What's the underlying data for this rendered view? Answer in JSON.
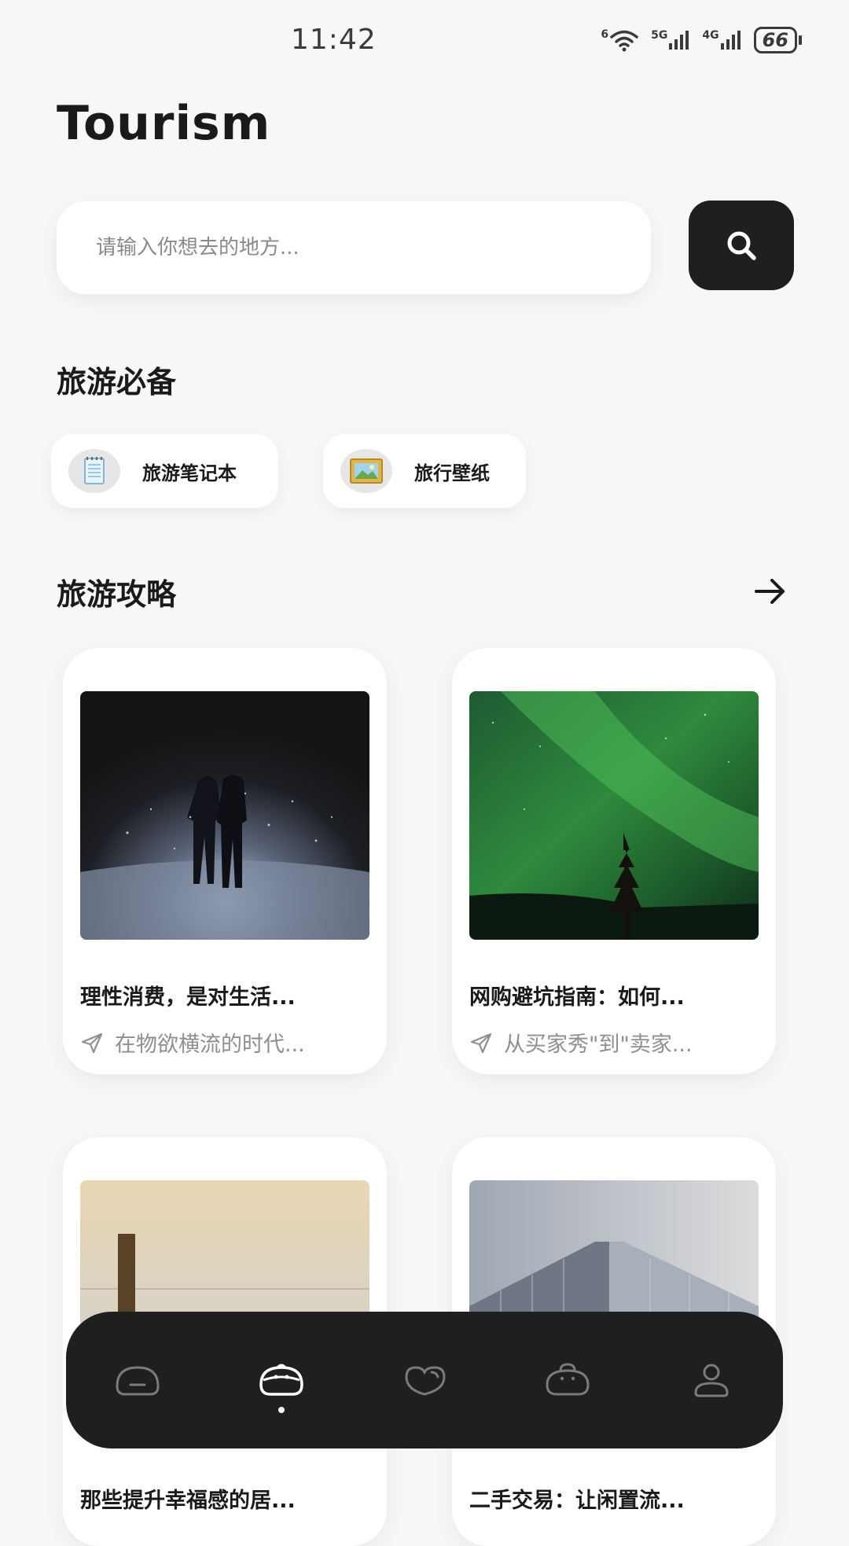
{
  "status_bar": {
    "time": "11:42",
    "wifi_label": "6",
    "signal_1_label": "5G",
    "signal_2_label": "4G",
    "battery": "66",
    "icons": [
      "wifi-icon",
      "signal-icon",
      "signal-icon",
      "battery-icon"
    ]
  },
  "header": {
    "title": "Tourism"
  },
  "search": {
    "placeholder": "请输入你想去的地方...",
    "value": "",
    "button_icon": "search-icon"
  },
  "essentials": {
    "title": "旅游必备",
    "items": [
      {
        "label": "旅游笔记本",
        "icon": "notebook-icon"
      },
      {
        "label": "旅行壁纸",
        "icon": "framed-picture-icon"
      }
    ]
  },
  "guides": {
    "title": "旅游攻略",
    "more_icon": "arrow-right-icon",
    "cards": [
      {
        "title": "理性消费，是对生活...",
        "subtitle": "在物欲横流的时代...",
        "image": "couple-in-snow-photo"
      },
      {
        "title": "网购避坑指南：如何...",
        "subtitle": "从买家秀\"到\"卖家...",
        "image": "aurora-night-photo"
      },
      {
        "title": "那些提升幸福感的居...",
        "subtitle": "",
        "image": "wooden-post-lake-photo"
      },
      {
        "title": "二手交易：让闲置流...",
        "subtitle": "",
        "image": "glass-building-photo"
      }
    ]
  },
  "tab_bar": {
    "tabs": [
      {
        "icon": "home-icon",
        "active": false
      },
      {
        "icon": "face-icon",
        "active": true
      },
      {
        "icon": "heart-icon",
        "active": false
      },
      {
        "icon": "bag-icon",
        "active": false
      },
      {
        "icon": "user-icon",
        "active": false
      }
    ],
    "colors": {
      "background": "#1f1f1f",
      "active": "#ffffff",
      "inactive": "#7a7a7a"
    }
  }
}
